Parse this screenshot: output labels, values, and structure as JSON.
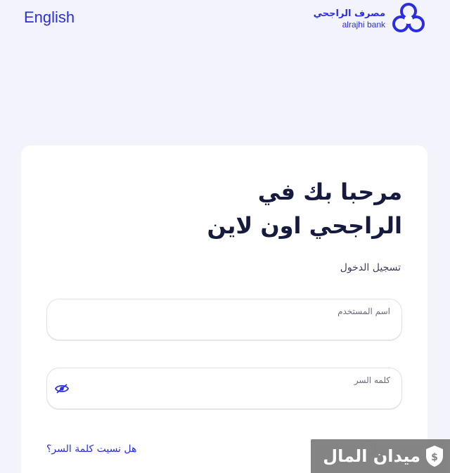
{
  "header": {
    "language_link": "English",
    "logo_ar": "مصرف الراجحي",
    "logo_en": "alrajhi bank"
  },
  "login": {
    "welcome_line1": "مرحبا بك في",
    "welcome_line2": "الراجحي اون لاين",
    "section_label": "تسجيل الدخول",
    "username_label": "اسم المستخدم",
    "username_value": "",
    "password_label": "كلمه السر",
    "password_value": "",
    "forgot_link": "هل نسيت كلمة السر؟"
  },
  "watermark": {
    "text": "ميدان المال"
  },
  "colors": {
    "brand": "#2a2ee0",
    "background": "#f3f4fb",
    "heading": "#151a3e"
  },
  "icons": {
    "logo": "alrajhi-logo-icon",
    "password_toggle": "eye-slash-icon",
    "watermark": "money-shield-icon"
  }
}
